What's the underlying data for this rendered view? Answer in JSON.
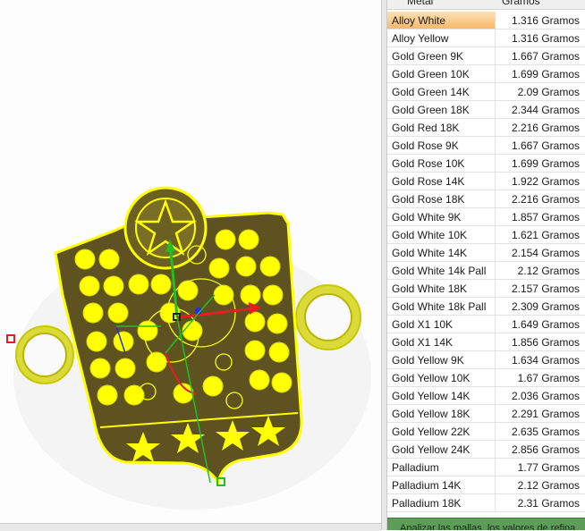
{
  "table": {
    "col_metal": "Metal",
    "col_grams": "Gramos",
    "rows": [
      {
        "metal": "Alloy White",
        "grams": "1.316 Gramos"
      },
      {
        "metal": "Alloy Yellow",
        "grams": "1.316 Gramos"
      },
      {
        "metal": "Gold Green 9K",
        "grams": "1.667 Gramos"
      },
      {
        "metal": "Gold Green 10K",
        "grams": "1.699 Gramos"
      },
      {
        "metal": "Gold Green 14K",
        "grams": "2.09 Gramos"
      },
      {
        "metal": "Gold Green 18K",
        "grams": "2.344 Gramos"
      },
      {
        "metal": "Gold Red 18K",
        "grams": "2.216 Gramos"
      },
      {
        "metal": "Gold Rose 9K",
        "grams": "1.667 Gramos"
      },
      {
        "metal": "Gold Rose 10K",
        "grams": "1.699 Gramos"
      },
      {
        "metal": "Gold Rose 14K",
        "grams": "1.922 Gramos"
      },
      {
        "metal": "Gold Rose 18K",
        "grams": "2.216 Gramos"
      },
      {
        "metal": "Gold White 9K",
        "grams": "1.857 Gramos"
      },
      {
        "metal": "Gold White 10K",
        "grams": "1.621 Gramos"
      },
      {
        "metal": "Gold White 14K",
        "grams": "2.154 Gramos"
      },
      {
        "metal": "Gold White 14k Pall",
        "grams": "2.12 Gramos"
      },
      {
        "metal": "Gold White 18K",
        "grams": "2.157 Gramos"
      },
      {
        "metal": "Gold White 18k Pall",
        "grams": "2.309 Gramos"
      },
      {
        "metal": "Gold X1 10K",
        "grams": "1.649 Gramos"
      },
      {
        "metal": "Gold X1 14K",
        "grams": "1.856 Gramos"
      },
      {
        "metal": "Gold Yellow 9K",
        "grams": "1.634 Gramos"
      },
      {
        "metal": "Gold Yellow 10K",
        "grams": "1.67 Gramos"
      },
      {
        "metal": "Gold Yellow 14K",
        "grams": "2.036 Gramos"
      },
      {
        "metal": "Gold Yellow 18K",
        "grams": "2.291 Gramos"
      },
      {
        "metal": "Gold Yellow 22K",
        "grams": "2.635 Gramos"
      },
      {
        "metal": "Gold Yellow 24K",
        "grams": "2.856 Gramos"
      },
      {
        "metal": "Palladium",
        "grams": "1.77 Gramos"
      },
      {
        "metal": "Palladium 14K",
        "grams": "2.12 Gramos"
      },
      {
        "metal": "Palladium 18K",
        "grams": "2.31 Gramos"
      }
    ],
    "selected_index": 0
  },
  "footer_button": "Analizar las mallas, los valores de refina",
  "colors": {
    "selection": "#f8b86a",
    "wireframe": "#ffff00",
    "metal_dark": "#5e5320",
    "axis_x": "#e02020",
    "axis_y": "#20c020",
    "axis_z": "#2030e0",
    "button_green": "#5c9e58"
  },
  "icons": {
    "model": "star-shield-charm-model",
    "gizmo": "transform-gizmo-icon"
  }
}
